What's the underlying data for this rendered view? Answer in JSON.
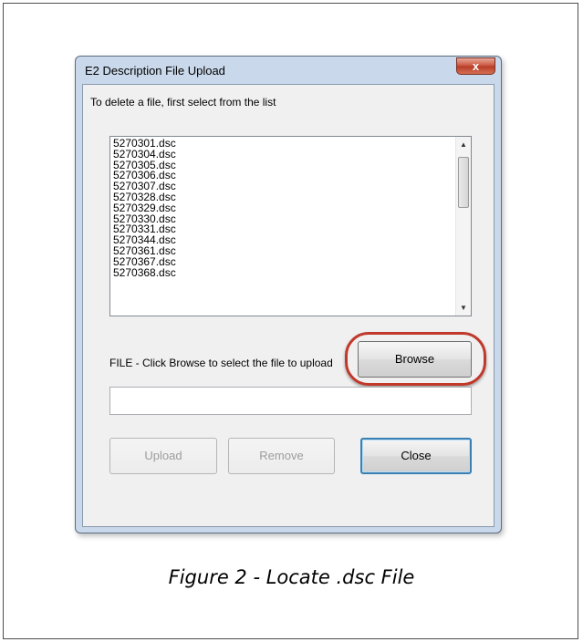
{
  "window": {
    "title": "E2 Description File Upload",
    "close_glyph": "x"
  },
  "instructions": "To delete a file, first select from the list",
  "file_list": [
    "5270301.dsc",
    "5270304.dsc",
    "5270305.dsc",
    "5270306.dsc",
    "5270307.dsc",
    "5270328.dsc",
    "5270329.dsc",
    "5270330.dsc",
    "5270331.dsc",
    "5270344.dsc",
    "5270361.dsc",
    "5270367.dsc",
    "5270368.dsc"
  ],
  "file_section": {
    "label": "FILE - Click Browse to select the file to upload",
    "browse_label": "Browse",
    "path_value": ""
  },
  "buttons": {
    "upload": "Upload",
    "remove": "Remove",
    "close": "Close"
  },
  "caption": "Figure 2 - Locate .dsc File",
  "colors": {
    "highlight_ring": "#c0392b",
    "dialog_frame": "#c9d8ea",
    "close_button": "#c7503a"
  }
}
